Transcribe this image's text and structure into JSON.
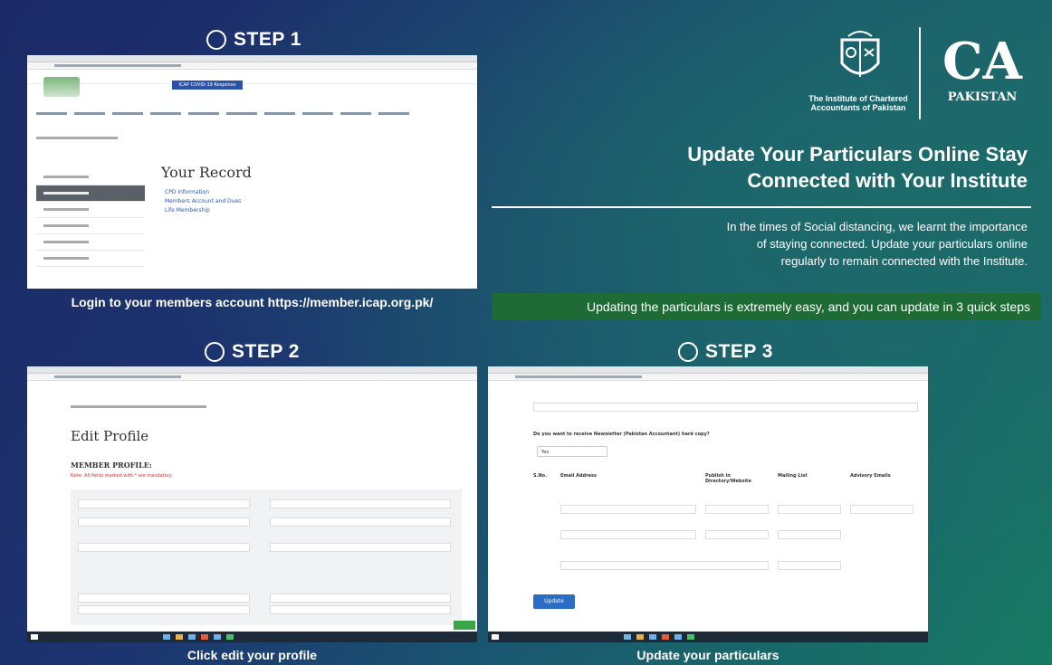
{
  "steps": [
    {
      "title": "STEP 1",
      "caption": "Login to your members account https://member.icap.org.pk/",
      "icon": "user-search-icon"
    },
    {
      "title": "STEP 2",
      "caption": "Click edit your profile",
      "icon": "user-edit-icon"
    },
    {
      "title": "STEP 3",
      "caption": "Update your particulars",
      "icon": "refresh-icon"
    }
  ],
  "step1_screen": {
    "record_title": "Your Record",
    "links": [
      "CPD Information",
      "Members Account and Dues",
      "Life Membership"
    ],
    "button": "ICAP COVID-19 Response"
  },
  "step2_screen": {
    "title": "Edit Profile",
    "section": "MEMBER PROFILE:",
    "note": "Note: All fields marked with * are mandatory."
  },
  "step3_screen": {
    "question": "Do you want to receive Newsletter (Pakistan Accountant) hard copy?",
    "select_value": "Yes",
    "columns": [
      "S.No.",
      "Email Address",
      "Publish in Directory/Website",
      "Mailing List",
      "Advisory Emails"
    ],
    "update_button": "Update"
  },
  "brand": {
    "institute": "The Institute of Chartered Accountants of Pakistan",
    "ca": "CA",
    "pakistan": "PAKISTAN"
  },
  "headline": {
    "line1": "Update Your Particulars Online Stay",
    "line2": "Connected with Your Institute"
  },
  "body": {
    "line1": "In the times of Social distancing, we learnt the importance",
    "line2": "of staying connected. Update your particulars online",
    "line3": "regularly to remain connected with the Institute."
  },
  "banner": "Updating the particulars is extremely easy, and you can update in 3 quick steps"
}
